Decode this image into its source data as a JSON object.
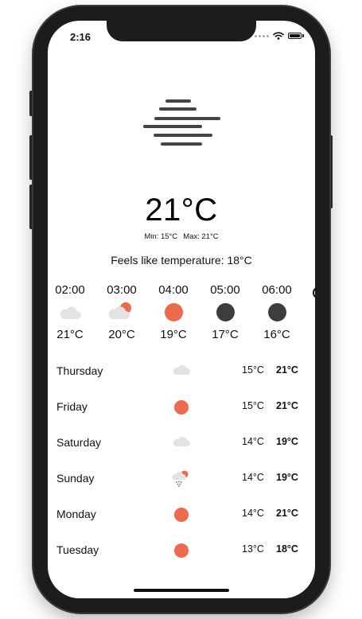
{
  "status": {
    "time": "2:16"
  },
  "current": {
    "condition_icon": "fog-icon",
    "temperature": "21°C",
    "min": "Min: 15°C",
    "max": "Max: 21°C",
    "feels_like": "Feels like temperature: 18°C"
  },
  "hourly": [
    {
      "time": "02:00",
      "icon": "cloud-icon",
      "temp": "21°C"
    },
    {
      "time": "03:00",
      "icon": "partly-cloudy-icon",
      "temp": "20°C"
    },
    {
      "time": "04:00",
      "icon": "sun-icon",
      "temp": "19°C"
    },
    {
      "time": "05:00",
      "icon": "moon-icon",
      "temp": "17°C"
    },
    {
      "time": "06:00",
      "icon": "moon-icon",
      "temp": "16°C"
    }
  ],
  "daily": [
    {
      "day": "Thursday",
      "icon": "cloud-icon",
      "min": "15°C",
      "max": "21°C"
    },
    {
      "day": "Friday",
      "icon": "sun-icon",
      "min": "15°C",
      "max": "21°C"
    },
    {
      "day": "Saturday",
      "icon": "cloud-icon",
      "min": "14°C",
      "max": "19°C"
    },
    {
      "day": "Sunday",
      "icon": "rain-sun-icon",
      "min": "14°C",
      "max": "19°C"
    },
    {
      "day": "Monday",
      "icon": "sun-icon",
      "min": "14°C",
      "max": "21°C"
    },
    {
      "day": "Tuesday",
      "icon": "sun-icon",
      "min": "13°C",
      "max": "18°C"
    }
  ],
  "colors": {
    "sun": "#ee6a4c",
    "night": "#3d3d3d",
    "cloud": "#e3e3e3",
    "fog": "#444444"
  }
}
